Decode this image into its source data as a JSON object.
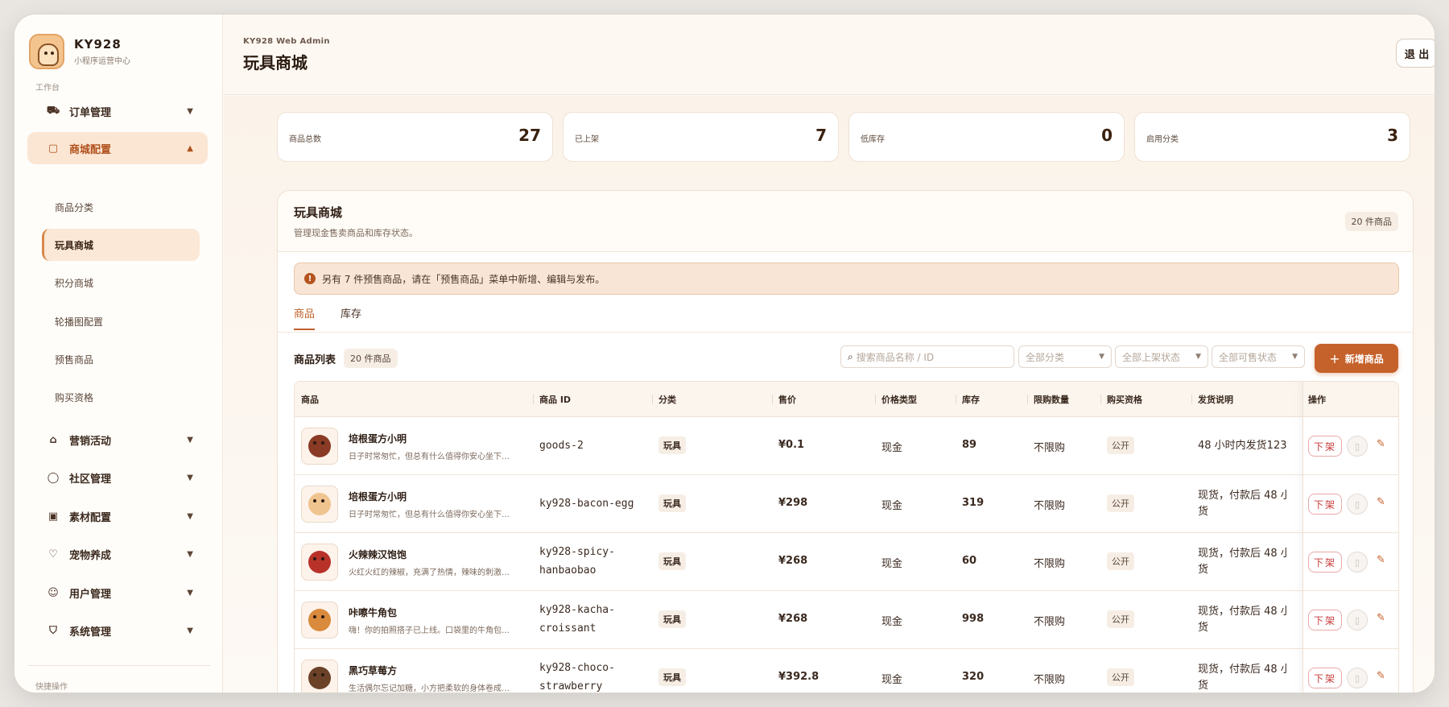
{
  "brand": {
    "name": "KY928",
    "subtitle": "小程序运营中心"
  },
  "sidebar": {
    "group_workbench": "工作台",
    "group_shortcuts": "快捷操作",
    "items": [
      {
        "label": "订单管理",
        "icon": "truck-icon"
      },
      {
        "label": "商城配置",
        "icon": "bag-icon"
      },
      {
        "label": "营销活动",
        "icon": "gift-icon"
      },
      {
        "label": "社区管理",
        "icon": "chat-icon"
      },
      {
        "label": "素材配置",
        "icon": "image-icon"
      },
      {
        "label": "宠物养成",
        "icon": "heart-icon"
      },
      {
        "label": "用户管理",
        "icon": "users-icon"
      },
      {
        "label": "系统管理",
        "icon": "shield-icon"
      }
    ],
    "sub_items": [
      "商品分类",
      "玩具商城",
      "积分商城",
      "轮播图配置",
      "预售商品",
      "购买资格"
    ]
  },
  "header": {
    "kicker": "KY928 Web Admin",
    "title": "玩具商城",
    "logout": "退 出"
  },
  "stats": [
    {
      "label": "商品总数",
      "value": "27"
    },
    {
      "label": "已上架",
      "value": "7"
    },
    {
      "label": "低库存",
      "value": "0"
    },
    {
      "label": "启用分类",
      "value": "3"
    }
  ],
  "panel": {
    "title": "玩具商城",
    "desc": "管理现金售卖商品和库存状态。",
    "count": "20 件商品",
    "notice": "另有 7 件预售商品，请在「预售商品」菜单中新增、编辑与发布。",
    "notice_icon": "!",
    "tabs": [
      "商品",
      "库存"
    ],
    "list_title": "商品列表",
    "list_count": "20 件商品",
    "search_placeholder": "搜索商品名称 / ID",
    "filters": [
      "全部分类",
      "全部上架状态",
      "全部可售状态"
    ],
    "add_button": "新增商品",
    "add_icon": "+"
  },
  "table": {
    "headers": [
      "商品",
      "商品 ID",
      "分类",
      "售价",
      "价格类型",
      "库存",
      "限购数量",
      "购买资格",
      "发货说明",
      "操作"
    ],
    "action_down": "下架",
    "rows": [
      {
        "name": "培根蛋方小明",
        "desc": "日子时常匆忙，但总有什么值得你安心坐下…",
        "id_lines": [
          "goods-2"
        ],
        "category": "玩具",
        "price": "¥0.1",
        "price_type": "现金",
        "stock": "89",
        "limit": "不限购",
        "eligibility": "公开",
        "ship_lines": [
          "48 小时内发货123"
        ],
        "thumb_color": "#8a3a25"
      },
      {
        "name": "培根蛋方小明",
        "desc": "日子时常匆忙，但总有什么值得你安心坐下…",
        "id_lines": [
          "ky928-bacon-egg"
        ],
        "category": "玩具",
        "price": "¥298",
        "price_type": "现金",
        "stock": "319",
        "limit": "不限购",
        "eligibility": "公开",
        "ship_lines": [
          "现货，付款后 48 小",
          "货"
        ],
        "thumb_color": "#f0c48f"
      },
      {
        "name": "火辣辣汉饱饱",
        "desc": "火红火红的辣椒，充满了热情，辣味的刺激…",
        "id_lines": [
          "ky928-spicy-",
          "hanbaobao"
        ],
        "category": "玩具",
        "price": "¥268",
        "price_type": "现金",
        "stock": "60",
        "limit": "不限购",
        "eligibility": "公开",
        "ship_lines": [
          "现货，付款后 48 小",
          "货"
        ],
        "thumb_color": "#b8322a"
      },
      {
        "name": "咔嚓牛角包",
        "desc": "嗨！你的拍照搭子已上线。口袋里的牛角包…",
        "id_lines": [
          "ky928-kacha-",
          "croissant"
        ],
        "category": "玩具",
        "price": "¥268",
        "price_type": "现金",
        "stock": "998",
        "limit": "不限购",
        "eligibility": "公开",
        "ship_lines": [
          "现货，付款后 48 小",
          "货"
        ],
        "thumb_color": "#d98a3c"
      },
      {
        "name": "黑巧草莓方",
        "desc": "生活偶尔忘记加糖，小方把柔软的身体卷成…",
        "id_lines": [
          "ky928-choco-",
          "strawberry"
        ],
        "category": "玩具",
        "price": "¥392.8",
        "price_type": "现金",
        "stock": "320",
        "limit": "不限购",
        "eligibility": "公开",
        "ship_lines": [
          "现货，付款后 48 小",
          "货"
        ],
        "thumb_color": "#6b4128"
      }
    ]
  },
  "colors": {
    "accent": "#c5612a",
    "danger": "#c83a3a",
    "sidebar_active": "#fbe6d3"
  }
}
